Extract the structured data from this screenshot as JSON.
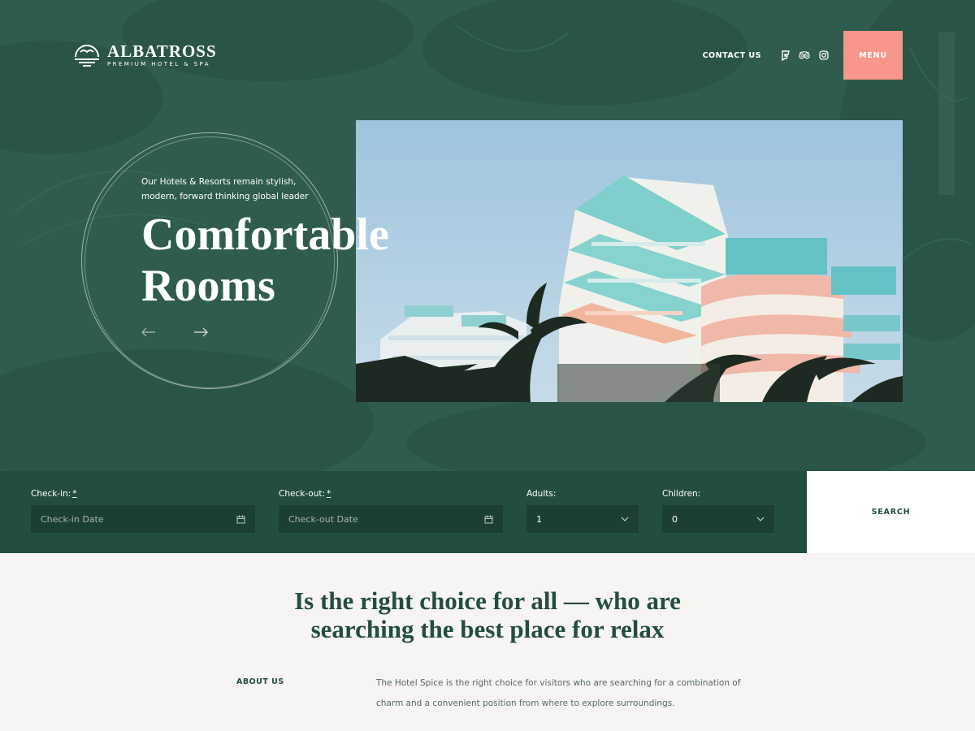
{
  "brand": {
    "name": "ALBATROSS",
    "tagline": "PREMIUM HOTEL & SPA",
    "logo_icon": "bird-sunset-icon"
  },
  "nav": {
    "contact_label": "CONTACT US",
    "social_icons": [
      "foursquare-icon",
      "tripadvisor-icon",
      "instagram-icon"
    ],
    "menu_label": "MENU"
  },
  "hero": {
    "subtitle": "Our Hotels & Resorts remain stylish, modern, forward thinking global leader",
    "title_line1": "Comfortable",
    "title_line2": "Rooms",
    "prev_icon": "arrow-left-icon",
    "next_icon": "arrow-right-icon"
  },
  "booking": {
    "checkin": {
      "label": "Check-in:",
      "required": "*",
      "placeholder": "Check-in Date",
      "icon": "calendar-icon"
    },
    "checkout": {
      "label": "Check-out:",
      "required": "*",
      "placeholder": "Check-out Date",
      "icon": "calendar-icon"
    },
    "adults": {
      "label": "Adults:",
      "value": "1",
      "icon": "chevron-down-icon"
    },
    "children": {
      "label": "Children:",
      "value": "0",
      "icon": "chevron-down-icon"
    },
    "search_label": "SEARCH"
  },
  "intro": {
    "heading_line1": "Is the right choice for all — who are",
    "heading_line2": "searching the best place for relax",
    "about_label": "ABOUT US",
    "about_text": "The Hotel Spice is the right choice for visitors who are searching for a combination of charm and a convenient position from where to explore surroundings."
  },
  "colors": {
    "hero_green": "#2f5c4e",
    "booking_green": "#244d41",
    "field_green": "#1c3f34",
    "accent_coral": "#f7968a",
    "cream": "#f7f5f0"
  }
}
